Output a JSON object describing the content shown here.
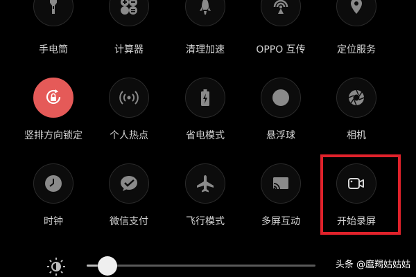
{
  "tiles": [
    {
      "label": "手电筒",
      "icon": "flashlight-icon",
      "active": false
    },
    {
      "label": "计算器",
      "icon": "calculator-icon",
      "active": false
    },
    {
      "label": "清理加速",
      "icon": "rocket-icon",
      "active": false
    },
    {
      "label": "OPPO 互传",
      "icon": "oppo-share-icon",
      "active": false
    },
    {
      "label": "定位服务",
      "icon": "location-icon",
      "active": false
    },
    {
      "label": "竖排方向锁定",
      "icon": "rotation-lock-icon",
      "active": true
    },
    {
      "label": "个人热点",
      "icon": "hotspot-icon",
      "active": false
    },
    {
      "label": "省电模式",
      "icon": "battery-saver-icon",
      "active": false
    },
    {
      "label": "悬浮球",
      "icon": "floating-ball-icon",
      "active": false
    },
    {
      "label": "相机",
      "icon": "camera-aperture-icon",
      "active": false
    },
    {
      "label": "时钟",
      "icon": "clock-icon",
      "active": false
    },
    {
      "label": "微信支付",
      "icon": "wechat-pay-icon",
      "active": false
    },
    {
      "label": "飞行模式",
      "icon": "airplane-icon",
      "active": false
    },
    {
      "label": "多屏互动",
      "icon": "screen-cast-icon",
      "active": false
    },
    {
      "label": "开始录屏",
      "icon": "screen-record-icon",
      "active": false
    }
  ],
  "highlighted_tile": "开始录屏",
  "brightness": {
    "icon": "brightness-icon",
    "level": 0.09
  },
  "colors": {
    "active": "#e55a58",
    "highlight": "#e0222b",
    "background": "#000000"
  },
  "watermark": "头条 @麿羯姑姑姑"
}
